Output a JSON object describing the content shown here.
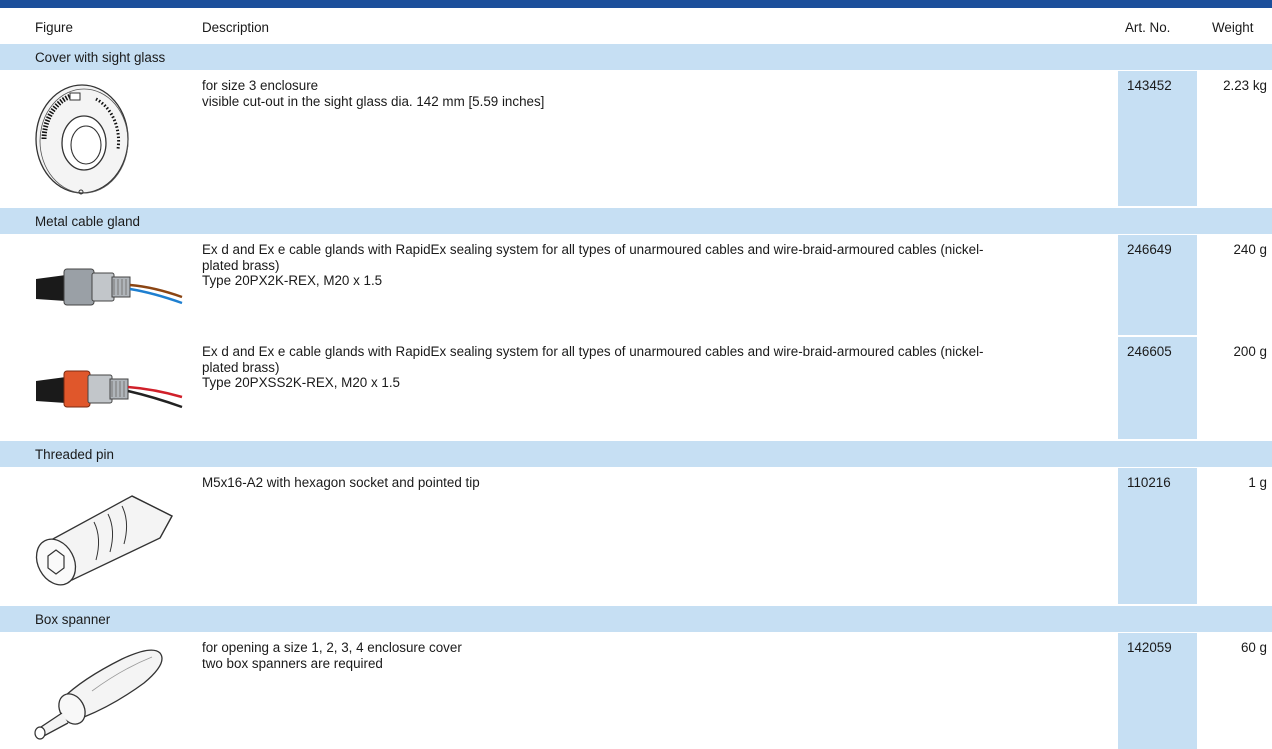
{
  "header": {
    "figure": "Figure",
    "description": "Description",
    "art_no": "Art. No.",
    "weight": "Weight"
  },
  "groups": [
    {
      "title": "Cover with sight glass",
      "items": [
        {
          "icon": "cover-sight-glass-icon",
          "description": "for size 3 enclosure\nvisible cut-out in the sight glass dia. 142 mm [5.59 inches]",
          "art_no": "143452",
          "weight": "2.23 kg"
        }
      ]
    },
    {
      "title": "Metal cable gland",
      "items": [
        {
          "icon": "metal-cable-gland-icon",
          "description": "Ex d and Ex e cable glands with RapidEx sealing system for all types of unarmoured cables and wire-braid-armoured cables (nickel-\nplated brass)\nType 20PX2K-REX, M20 x 1.5",
          "art_no": "246649",
          "weight": "240 g"
        },
        {
          "icon": "metal-cable-gland-red-seal-icon",
          "description": "Ex d and Ex e cable glands with RapidEx sealing system for all types of unarmoured cables and wire-braid-armoured cables (nickel-\nplated brass)\nType 20PXSS2K-REX, M20 x 1.5",
          "art_no": "246605",
          "weight": "200 g"
        }
      ]
    },
    {
      "title": "Threaded pin",
      "items": [
        {
          "icon": "threaded-pin-icon",
          "description": "M5x16-A2 with hexagon socket and pointed tip",
          "art_no": "110216",
          "weight": "1 g"
        }
      ]
    },
    {
      "title": "Box spanner",
      "items": [
        {
          "icon": "box-spanner-icon",
          "description": "for opening a size 1, 2, 3, 4 enclosure cover\ntwo box spanners are required",
          "art_no": "142059",
          "weight": "60 g"
        }
      ]
    }
  ],
  "colors": {
    "header_bar": "#1c4f9b",
    "group_band": "#c6dff3",
    "art_no_column": "#c6dff3"
  }
}
